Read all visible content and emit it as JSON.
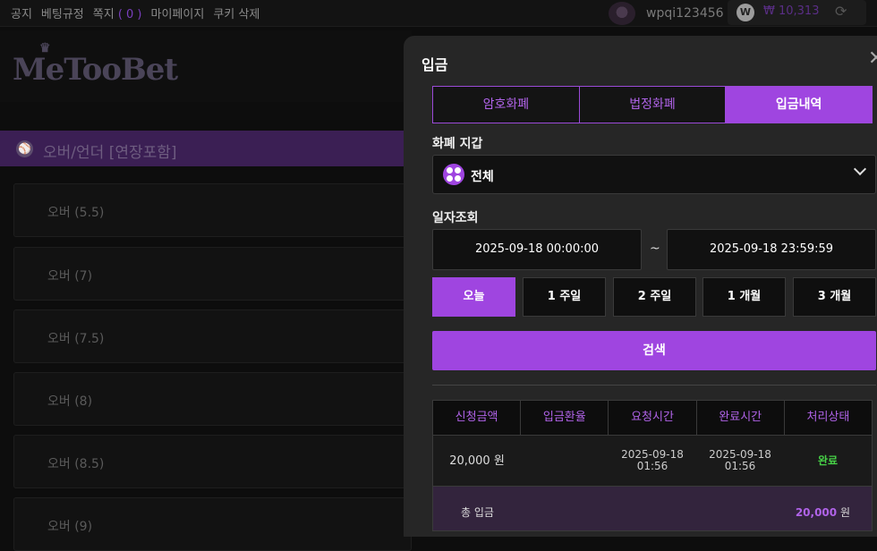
{
  "topnav": {
    "links": [
      "공지",
      "베팅규정",
      "쪽지",
      "마이페이지",
      "쿠키 삭제"
    ],
    "message_count": "( 0 )",
    "username": "wpqi123456",
    "coin_symbol": "W",
    "balance": "₩ 10,313"
  },
  "site": {
    "logo_text": "MeTooBet",
    "section_title": "오버/언더 [연장포함]",
    "odds_rows": [
      "오버 (5.5)",
      "오버 (7)",
      "오버 (7.5)",
      "오버 (8)",
      "오버 (8.5)",
      "오버 (9)"
    ]
  },
  "modal": {
    "title": "입금",
    "tabs": [
      {
        "label": "암호화폐",
        "active": false
      },
      {
        "label": "법정화폐",
        "active": false
      },
      {
        "label": "입금내역",
        "active": true
      }
    ],
    "wallet_label": "화폐 지갑",
    "wallet_value": "전체",
    "date_label": "일자조회",
    "date_from": "2025-09-18 00:00:00",
    "date_separator": "~",
    "date_to": "2025-09-18 23:59:59",
    "periods": [
      {
        "label": "오늘",
        "active": true
      },
      {
        "label": "1 주일",
        "active": false
      },
      {
        "label": "2 주일",
        "active": false
      },
      {
        "label": "1 개월",
        "active": false
      },
      {
        "label": "3 개월",
        "active": false
      }
    ],
    "search_label": "검색",
    "table": {
      "headers": [
        "신청금액",
        "입금환율",
        "요청시간",
        "완료시간",
        "처리상태"
      ],
      "rows": [
        {
          "amount": "20,000 원",
          "rate": "",
          "requested_date": "2025-09-18",
          "requested_time": "01:56",
          "completed_date": "2025-09-18",
          "completed_time": "01:56",
          "status": "완료"
        }
      ],
      "total_label": "총 입금",
      "total_value": "20,000",
      "total_unit": "원"
    }
  },
  "colors": {
    "accent": "#9f45e0",
    "status_done": "#47d147"
  }
}
